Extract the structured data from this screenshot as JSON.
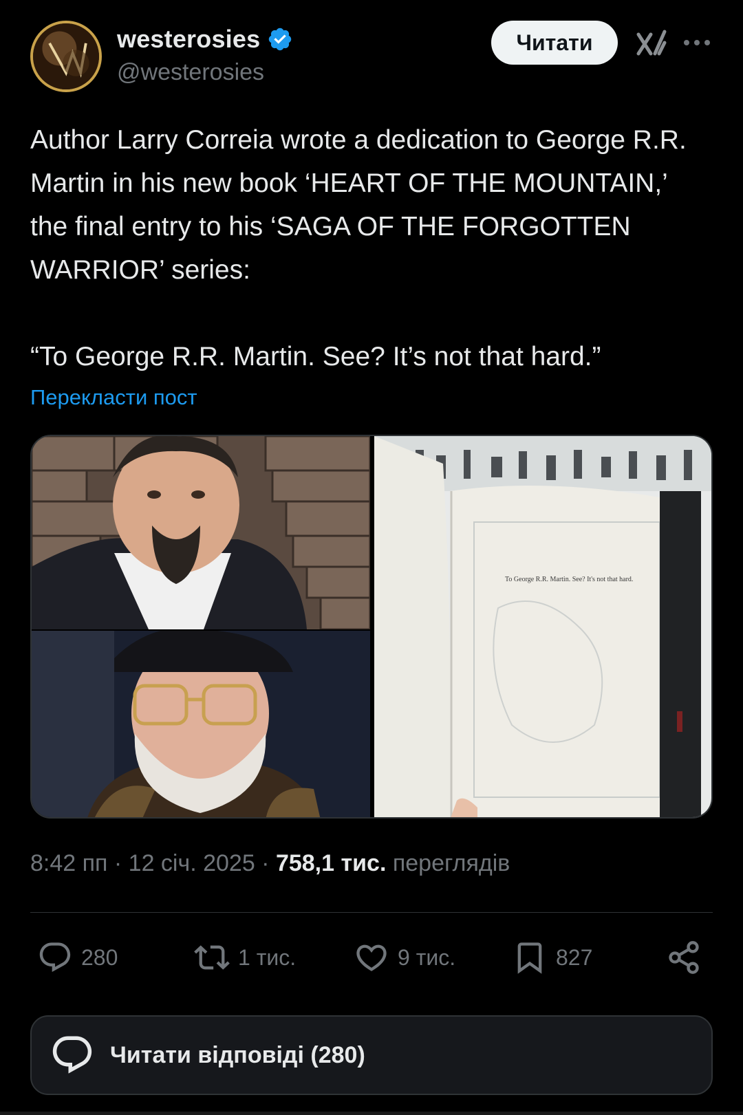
{
  "author": {
    "display_name": "westerosies",
    "handle": "@westerosies",
    "verified": true,
    "avatar_icon": "avatar-image"
  },
  "follow_label": "Читати",
  "post": {
    "text": "Author Larry Correia wrote a dedication to George R.R. Martin in his new book ‘HEART OF THE MOUNTAIN,’ the final entry to his ‘SAGA OF THE FORGOTTEN WARRIOR’ series:\n\n“To George R.R. Martin. See? It’s not that hard.”",
    "translate_label": "Перекласти пост",
    "book_page_text": "To George R.R. Martin. See? It's not that hard."
  },
  "meta": {
    "time": "8:42 пп",
    "date": "12 січ. 2025",
    "separator": " · ",
    "views_count": "758,1 тис.",
    "views_label": "переглядів"
  },
  "actions": {
    "replies": "280",
    "reposts": "1 тис.",
    "likes": "9 тис.",
    "bookmarks": "827"
  },
  "replies_button_label": "Читати відповіді (280)",
  "colors": {
    "background": "#000000",
    "text": "#e7e9ea",
    "muted": "#71767b",
    "accent": "#1d9bf0",
    "border": "#2f3336"
  }
}
